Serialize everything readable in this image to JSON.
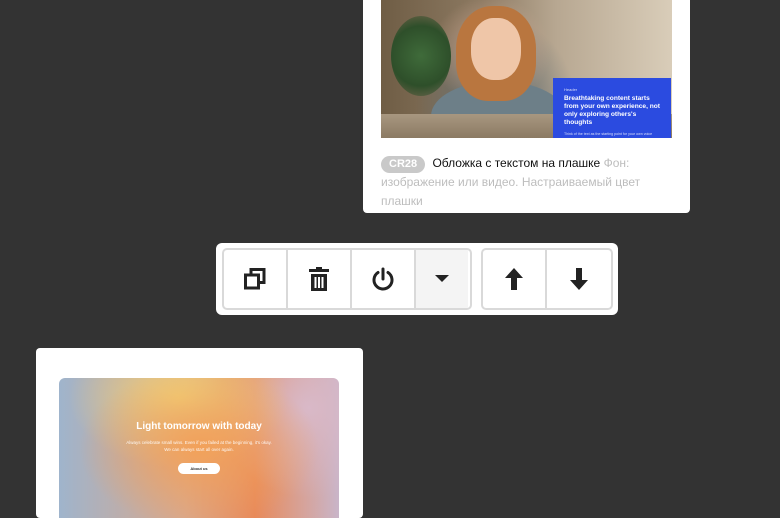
{
  "top_card": {
    "photo_name": "woman-at-table-photo",
    "promo": {
      "eyebrow": "Header",
      "headline": "Breathtaking content starts from your own experience, not only exploring others's thoughts",
      "fine": "Think of the text as the starting point for your own voice"
    },
    "badge": "CR28",
    "name": "Обложка с текстом на плашке",
    "description": "Фон: изображение или видео. Настраиваемый цвет плашки"
  },
  "toolbar": {
    "buttons": [
      {
        "icon": "duplicate-icon"
      },
      {
        "icon": "trash-icon"
      },
      {
        "icon": "power-icon"
      },
      {
        "icon": "caret-down-icon"
      },
      {
        "icon": "arrow-up-icon"
      },
      {
        "icon": "arrow-down-icon"
      }
    ]
  },
  "bottom_card": {
    "title": "Light tomorrow with today",
    "text": "Always celebrate small wins. Even if you failed at the beginning, it's okay. We can always start all over again.",
    "button": "About us"
  },
  "colors": {
    "background": "#333333",
    "promo_blue": "#2b4be0",
    "badge_grey": "#c9c9c9",
    "icon": "#222222"
  }
}
